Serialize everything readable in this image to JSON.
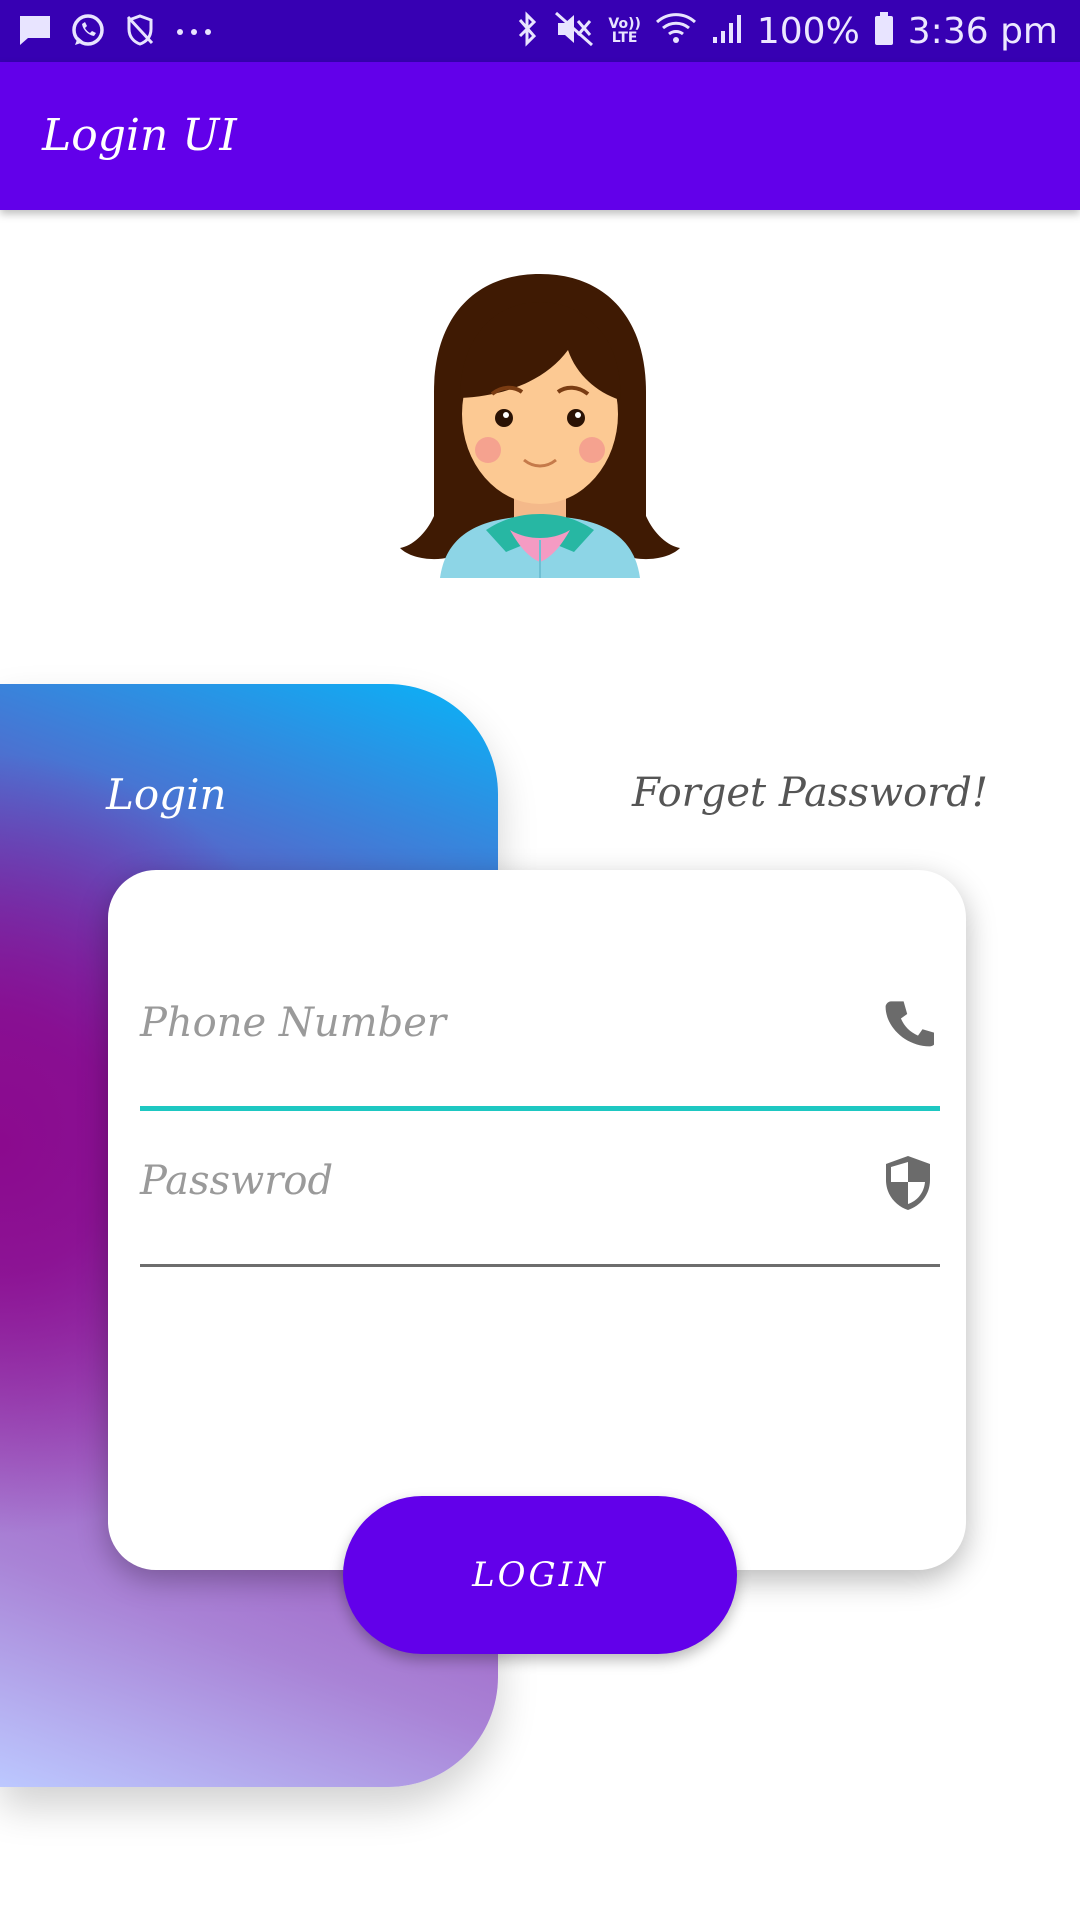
{
  "status_bar": {
    "left_icons": [
      "message-icon",
      "whatsapp-icon",
      "shield-off-icon",
      "more-dots-icon"
    ],
    "volte_top": "Vo))",
    "volte_bottom": "LTE",
    "battery": "100%",
    "time": "3:36 pm"
  },
  "app_bar": {
    "title": "Login UI"
  },
  "tabs": {
    "login": "Login",
    "forget": "Forget Password!"
  },
  "form": {
    "phone_placeholder": "Phone Number",
    "password_placeholder": "Passwrod",
    "login_button": "LOGIN"
  },
  "colors": {
    "status_bar": "#3700b3",
    "app_bar": "#6200ea",
    "accent": "#1ec8c2",
    "button": "#6200ea"
  }
}
